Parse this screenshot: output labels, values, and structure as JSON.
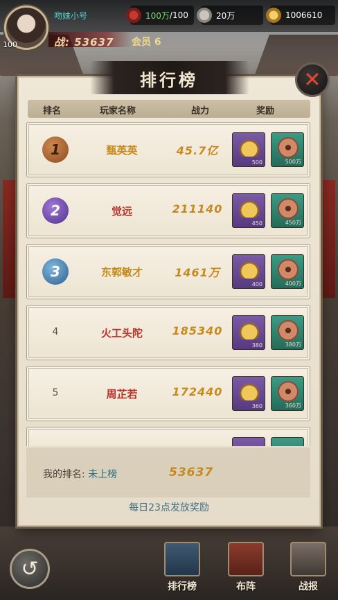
{
  "player": {
    "name": "吻妹小号",
    "level": "100",
    "power_label": "战: 53637",
    "vip_label": "会员 6"
  },
  "resources": {
    "stamina_current": "100万",
    "stamina_max": "/100",
    "silver": "20万",
    "gold": "1006610"
  },
  "panel": {
    "title": "排行榜",
    "columns": {
      "rank": "排名",
      "name": "玩家名称",
      "power": "战力",
      "reward": "奖励"
    }
  },
  "leaderboard": [
    {
      "rank": "1",
      "name": "甄英英",
      "power": "45.7亿",
      "ingot_qty": "500",
      "coin_qty": "500万"
    },
    {
      "rank": "2",
      "name": "觉远",
      "power": "211140",
      "ingot_qty": "450",
      "coin_qty": "450万"
    },
    {
      "rank": "3",
      "name": "东郭敏才",
      "power": "1461万",
      "ingot_qty": "400",
      "coin_qty": "400万"
    },
    {
      "rank": "4",
      "name": "火工头陀",
      "power": "185340",
      "ingot_qty": "380",
      "coin_qty": "380万"
    },
    {
      "rank": "5",
      "name": "周芷若",
      "power": "172440",
      "ingot_qty": "360",
      "coin_qty": "360万"
    }
  ],
  "my_rank": {
    "label": "我的排名:",
    "status": "未上榜",
    "power": "53637"
  },
  "daily_note": "每日23点发放奖励",
  "nav": {
    "rank": "排行榜",
    "formation": "布阵",
    "report": "战报"
  },
  "colors": {
    "name_gold": "#c58a1a",
    "name_red": "#b8322a",
    "power_gold": "#c8891c"
  }
}
